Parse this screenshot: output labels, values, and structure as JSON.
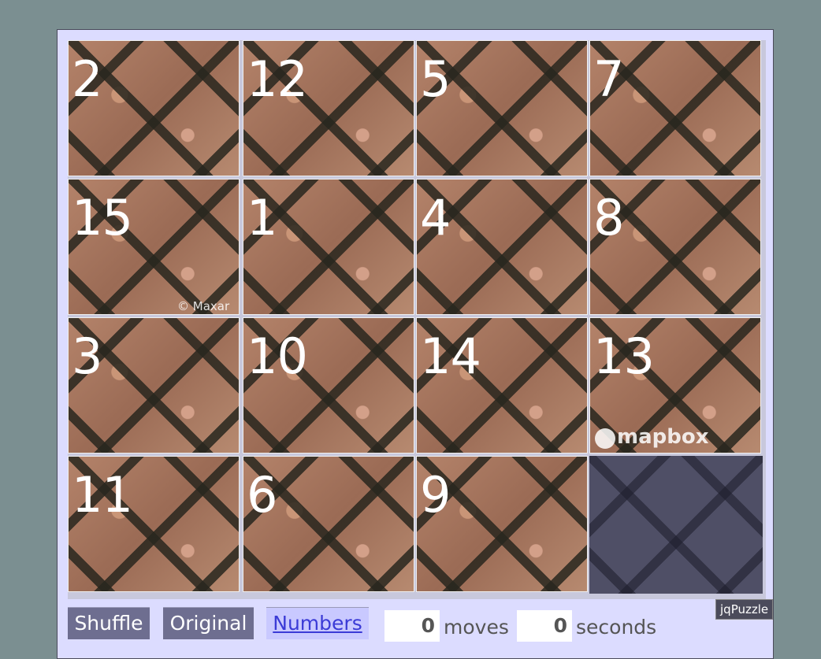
{
  "puzzle": {
    "tiles": [
      {
        "label": "2"
      },
      {
        "label": "12"
      },
      {
        "label": "5"
      },
      {
        "label": "7"
      },
      {
        "label": "15"
      },
      {
        "label": "1"
      },
      {
        "label": "4"
      },
      {
        "label": "8"
      },
      {
        "label": "3"
      },
      {
        "label": "10"
      },
      {
        "label": "14"
      },
      {
        "label": "13"
      },
      {
        "label": "11"
      },
      {
        "label": "6"
      },
      {
        "label": "9"
      }
    ],
    "watermark_maxar": "© Maxar",
    "watermark_mapbox": "mapbox"
  },
  "controls": {
    "shuffle_label": "Shuffle",
    "original_label": "Original",
    "numbers_label": "Numbers",
    "moves_value": "0",
    "moves_label": "moves",
    "seconds_value": "0",
    "seconds_label": "seconds",
    "brand_label": "jqPuzzle"
  }
}
